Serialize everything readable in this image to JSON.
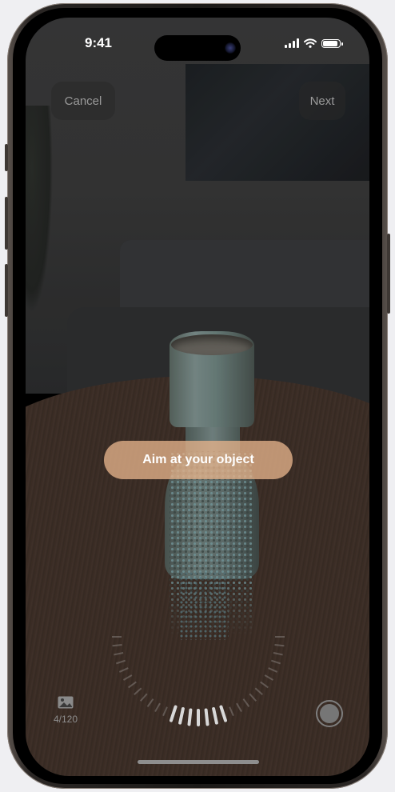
{
  "status_bar": {
    "time": "9:41",
    "battery_level": 0.9
  },
  "toolbar": {
    "cancel_label": "Cancel",
    "next_label": "Next"
  },
  "prompt": {
    "text": "Aim at your object"
  },
  "capture": {
    "count_label": "4/120",
    "gallery_icon": "photo-icon",
    "shutter_icon": "shutter-icon"
  },
  "icons": {
    "signal": "cellular-signal-icon",
    "wifi": "wifi-icon",
    "battery": "battery-icon"
  },
  "colors": {
    "prompt_pill": "#e4b28a",
    "button_bg": "#282828",
    "muted_text": "#9a9a9a"
  }
}
